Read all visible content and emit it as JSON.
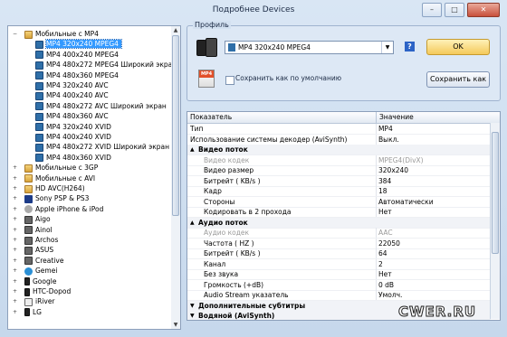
{
  "window": {
    "title": "Подробнее Devices",
    "buttons": [
      "–",
      "□",
      "✕"
    ]
  },
  "tree": {
    "items": [
      {
        "label": "Мобильные с MP4",
        "level": 0,
        "icon": "folder-icon",
        "expand": "−"
      },
      {
        "label": "MP4 320x240 MPEG4",
        "level": 1,
        "icon": "mp4-icon",
        "selected": true
      },
      {
        "label": "MP4 400x240 MPEG4",
        "level": 1,
        "icon": "mp4-icon"
      },
      {
        "label": "MP4 480x272 MPEG4 Широкий экран",
        "level": 1,
        "icon": "mp4-icon"
      },
      {
        "label": "MP4 480x360 MPEG4",
        "level": 1,
        "icon": "mp4-icon"
      },
      {
        "label": "MP4 320x240 AVC",
        "level": 1,
        "icon": "mp4-icon"
      },
      {
        "label": "MP4 400x240 AVC",
        "level": 1,
        "icon": "mp4-icon"
      },
      {
        "label": "MP4 480x272 AVC Широкий экран",
        "level": 1,
        "icon": "mp4-icon"
      },
      {
        "label": "MP4 480x360 AVC",
        "level": 1,
        "icon": "mp4-icon"
      },
      {
        "label": "MP4 320x240 XVID",
        "level": 1,
        "icon": "mp4-icon"
      },
      {
        "label": "MP4 400x240 XVID",
        "level": 1,
        "icon": "mp4-icon"
      },
      {
        "label": "MP4 480x272 XVID Широкий экран",
        "level": 1,
        "icon": "mp4-icon"
      },
      {
        "label": "MP4 480x360 XVID",
        "level": 1,
        "icon": "mp4-icon"
      },
      {
        "label": "Мобильные с 3GP",
        "level": 0,
        "icon": "folder-icon",
        "expand": "+"
      },
      {
        "label": "Мобильные с AVI",
        "level": 0,
        "icon": "folder-icon",
        "expand": "+"
      },
      {
        "label": "HD AVC(H264)",
        "level": 0,
        "icon": "folder-icon",
        "expand": "+"
      },
      {
        "label": "Sony PSP & PS3",
        "level": 0,
        "icon": "playstation-icon",
        "expand": "+"
      },
      {
        "label": "Apple iPhone & iPod",
        "level": 0,
        "icon": "apple-icon",
        "expand": "+"
      },
      {
        "label": "Aigo",
        "level": 0,
        "icon": "device-icon",
        "expand": "+"
      },
      {
        "label": "Ainol",
        "level": 0,
        "icon": "device-icon",
        "expand": "+"
      },
      {
        "label": "Archos",
        "level": 0,
        "icon": "device-icon",
        "expand": "+"
      },
      {
        "label": "ASUS",
        "level": 0,
        "icon": "device-icon",
        "expand": "+"
      },
      {
        "label": "Creative",
        "level": 0,
        "icon": "device-icon",
        "expand": "+"
      },
      {
        "label": "Gemei",
        "level": 0,
        "icon": "gemei-icon",
        "expand": "+"
      },
      {
        "label": "Google",
        "level": 0,
        "icon": "phone-icon",
        "expand": "+"
      },
      {
        "label": "HTC-Dopod",
        "level": 0,
        "icon": "phone-icon",
        "expand": "+"
      },
      {
        "label": "iRiver",
        "level": 0,
        "icon": "ipod-icon",
        "expand": "+"
      },
      {
        "label": "LG",
        "level": 0,
        "icon": "phone-icon",
        "expand": "+"
      }
    ]
  },
  "profile": {
    "group_label": "Профиль",
    "selected": "MP4 320x240 MPEG4",
    "help": "?",
    "ok_label": "OK",
    "default_checkbox_label": "Сохранить как по умолчанию",
    "default_checked": false,
    "save_as_label": "Сохранить как",
    "file_icon_text": "MP4"
  },
  "grid": {
    "col_name": "Показатель",
    "col_value": "Значение",
    "rows": [
      {
        "k": "Тип",
        "v": "MP4",
        "type": "prop"
      },
      {
        "k": "Использование системы декодер (AviSynth)",
        "v": "Выкл.",
        "type": "prop"
      },
      {
        "k": "Видео поток",
        "v": "",
        "type": "cat",
        "tog": "▲"
      },
      {
        "k": "Видео кодек",
        "v": "MPEG4(DivX)",
        "type": "dis"
      },
      {
        "k": "Видео размер",
        "v": "320x240",
        "type": "prop"
      },
      {
        "k": "Битрейт ( KB/s )",
        "v": "384",
        "type": "prop"
      },
      {
        "k": "Кадр",
        "v": "18",
        "type": "prop"
      },
      {
        "k": "Стороны",
        "v": "Автоматически",
        "type": "prop"
      },
      {
        "k": "Кодировать в 2 прохода",
        "v": "Нет",
        "type": "prop"
      },
      {
        "k": "Аудио поток",
        "v": "",
        "type": "cat",
        "tog": "▲"
      },
      {
        "k": "Аудио кодек",
        "v": "AAC",
        "type": "dis"
      },
      {
        "k": "Частота ( HZ )",
        "v": "22050",
        "type": "prop"
      },
      {
        "k": "Битрейт ( KB/s )",
        "v": "64",
        "type": "prop"
      },
      {
        "k": "Канал",
        "v": "2",
        "type": "prop"
      },
      {
        "k": "Без звука",
        "v": "Нет",
        "type": "prop"
      },
      {
        "k": "Громкость (+dB)",
        "v": "0 dB",
        "type": "prop"
      },
      {
        "k": "Audio Stream указатель",
        "v": "Умолч.",
        "type": "prop"
      },
      {
        "k": "Дополнительные субтитры",
        "v": "",
        "type": "cat",
        "tog": "▼"
      },
      {
        "k": "Водяной (AviSynth)",
        "v": "",
        "type": "cat",
        "tog": "▼"
      }
    ]
  },
  "watermark": "CWER.RU"
}
